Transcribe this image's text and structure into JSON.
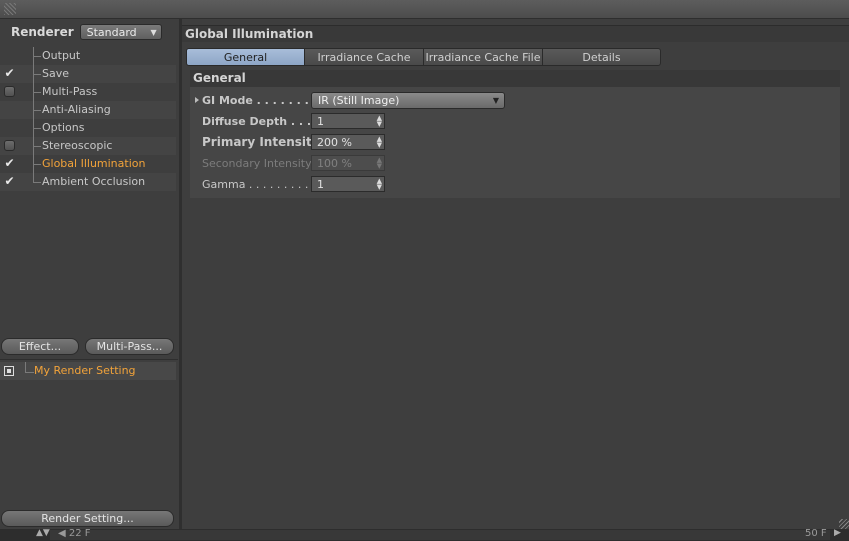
{
  "renderer": {
    "label": "Renderer",
    "value": "Standard"
  },
  "tree": [
    {
      "label": "Output",
      "check": "none"
    },
    {
      "label": "Save",
      "check": "checked"
    },
    {
      "label": "Multi-Pass",
      "check": "empty"
    },
    {
      "label": "Anti-Aliasing",
      "check": "none"
    },
    {
      "label": "Options",
      "check": "none"
    },
    {
      "label": "Stereoscopic",
      "check": "empty"
    },
    {
      "label": "Global Illumination",
      "check": "checked",
      "active": true
    },
    {
      "label": "Ambient Occlusion",
      "check": "checked"
    }
  ],
  "buttons": {
    "effect": "Effect...",
    "multipass": "Multi-Pass...",
    "render_setting": "Render Setting..."
  },
  "render_setting": {
    "name": "My Render Setting"
  },
  "panel": {
    "title": "Global Illumination",
    "tabs": [
      "General",
      "Irradiance Cache",
      "Irradiance Cache File",
      "Details"
    ],
    "active_tab": "General",
    "group_title": "General",
    "gi_mode": {
      "label": "GI Mode . . . . . . . . .",
      "value": "IR (Still Image)"
    },
    "diffuse_depth": {
      "label": "Diffuse Depth . . . .",
      "value": "1"
    },
    "primary_intensity": {
      "label": "Primary Intensity",
      "value": "200 %"
    },
    "secondary_intensity": {
      "label": "Secondary Intensity",
      "value": "100 %"
    },
    "gamma": {
      "label": "Gamma . . . . . . . . . . .",
      "value": "1"
    }
  },
  "status": {
    "frame_start": "22 F",
    "frame_end": "50 F"
  },
  "colors": {
    "active_tab": "#9ab0cf",
    "active_text": "#f2a33a",
    "background": "#3e3e3e"
  }
}
